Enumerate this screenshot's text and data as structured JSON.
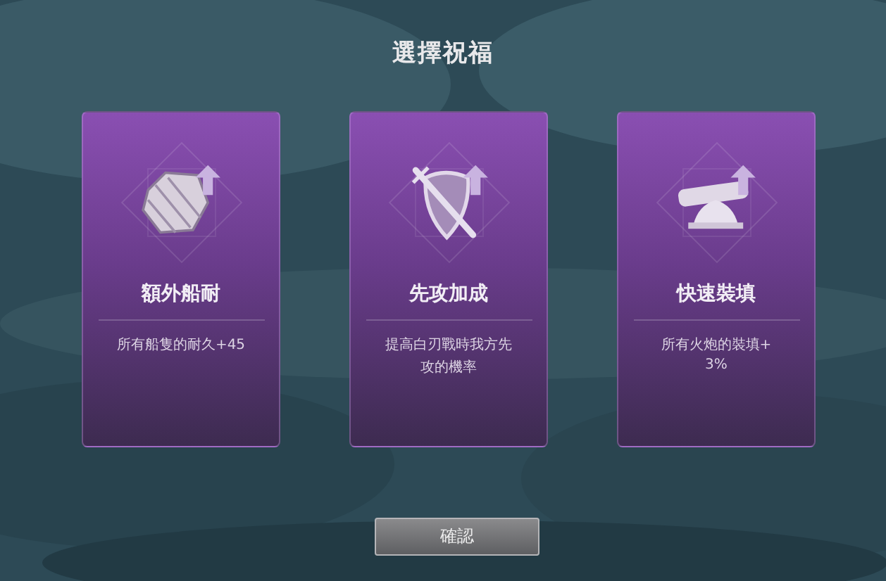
{
  "title": "選擇祝福",
  "cards": [
    {
      "kind": "plank",
      "name": "額外船耐",
      "description_lines": [
        "所有船隻的耐久+45"
      ]
    },
    {
      "kind": "shield",
      "name": "先攻加成",
      "description_lines": [
        "提高白刃戰時我方先",
        "攻的機率"
      ]
    },
    {
      "kind": "cannon",
      "name": "快速裝填",
      "description_lines": [
        "所有火炮的裝填+",
        "3%"
      ]
    }
  ],
  "confirm_button": "確認"
}
